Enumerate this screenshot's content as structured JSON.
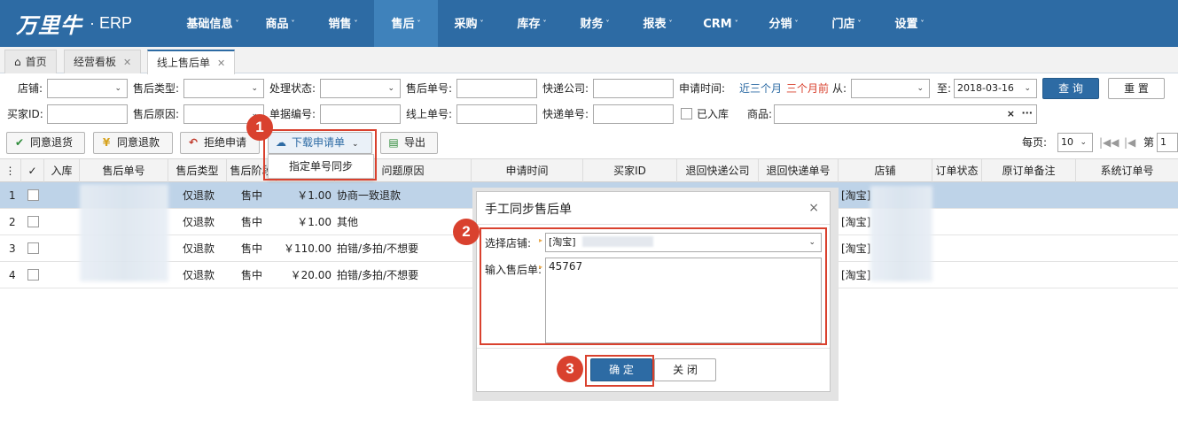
{
  "header": {
    "brand": "万里牛",
    "erp": "· ERP",
    "nav": [
      {
        "label": "基础信息"
      },
      {
        "label": "商品"
      },
      {
        "label": "销售"
      },
      {
        "label": "售后"
      },
      {
        "label": "采购"
      },
      {
        "label": "库存"
      },
      {
        "label": "财务"
      },
      {
        "label": "报表"
      },
      {
        "label": "CRM"
      },
      {
        "label": "分销"
      },
      {
        "label": "门店"
      },
      {
        "label": "设置"
      }
    ],
    "caret": "˅",
    "active_index": 3
  },
  "tabs": [
    {
      "label": "首页"
    },
    {
      "label": "经营看板"
    },
    {
      "label": "线上售后单"
    }
  ],
  "filters": {
    "store_label": "店铺:",
    "aftersale_type_label": "售后类型:",
    "status_label": "处理状态:",
    "aftersale_no_label": "售后单号:",
    "express_company_label": "快递公司:",
    "apply_time_label": "申请时间:",
    "last3": "近三个月",
    "prev3": "三个月前",
    "from_label": "从:",
    "to_label": "至:",
    "to_date": "2018-03-16",
    "query_btn": "查 询",
    "reset_btn": "重 置",
    "buyer_id_label": "买家ID:",
    "reason_label": "售后原因:",
    "doc_no_label": "单据编号:",
    "online_no_label": "线上单号:",
    "express_no_label": "快递单号:",
    "instock_label": "已入库",
    "goods_label": "商品:",
    "goods_clear": "×",
    "goods_more": "···"
  },
  "toolbar": {
    "agree_return": "同意退货",
    "agree_refund": "同意退款",
    "reject": "拒绝申请",
    "download": "下载申请单",
    "export": "导出",
    "per_page_label": "每页:",
    "per_page": "10",
    "page_label": "第",
    "page_num": "1"
  },
  "dropdown": {
    "item": "指定单号同步"
  },
  "grid": {
    "columns": [
      "入库",
      "售后单号",
      "售后类型",
      "售后阶段",
      "",
      "问题原因",
      "申请时间",
      "买家ID",
      "退回快递公司",
      "退回快递单号",
      "店铺",
      "订单状态",
      "原订单备注",
      "系统订单号"
    ],
    "rows": [
      {
        "no": "1",
        "type": "仅退款",
        "stage": "售中",
        "amount": "￥1.00",
        "reason": "协商一致退款",
        "store": "[淘宝]"
      },
      {
        "no": "2",
        "type": "仅退款",
        "stage": "售中",
        "amount": "￥1.00",
        "reason": "其他",
        "store": "[淘宝]"
      },
      {
        "no": "3",
        "type": "仅退款",
        "stage": "售中",
        "amount": "￥110.00",
        "reason": "拍错/多拍/不想要",
        "store": "[淘宝]"
      },
      {
        "no": "4",
        "type": "仅退款",
        "stage": "售中",
        "amount": "￥20.00",
        "reason": "拍错/多拍/不想要",
        "store": "[淘宝]"
      }
    ]
  },
  "dialog": {
    "title": "手工同步售后单",
    "close": "×",
    "store_label": "选择店铺:",
    "store_value": "[淘宝]",
    "no_label": "输入售后单:",
    "no_value": "45767",
    "ok": "确 定",
    "cancel": "关 闭"
  },
  "steps": [
    "1",
    "2",
    "3"
  ],
  "colors": {
    "primary": "#2d6ba4",
    "accent_red": "#d9412e",
    "selected_row": "#bed3e8"
  }
}
